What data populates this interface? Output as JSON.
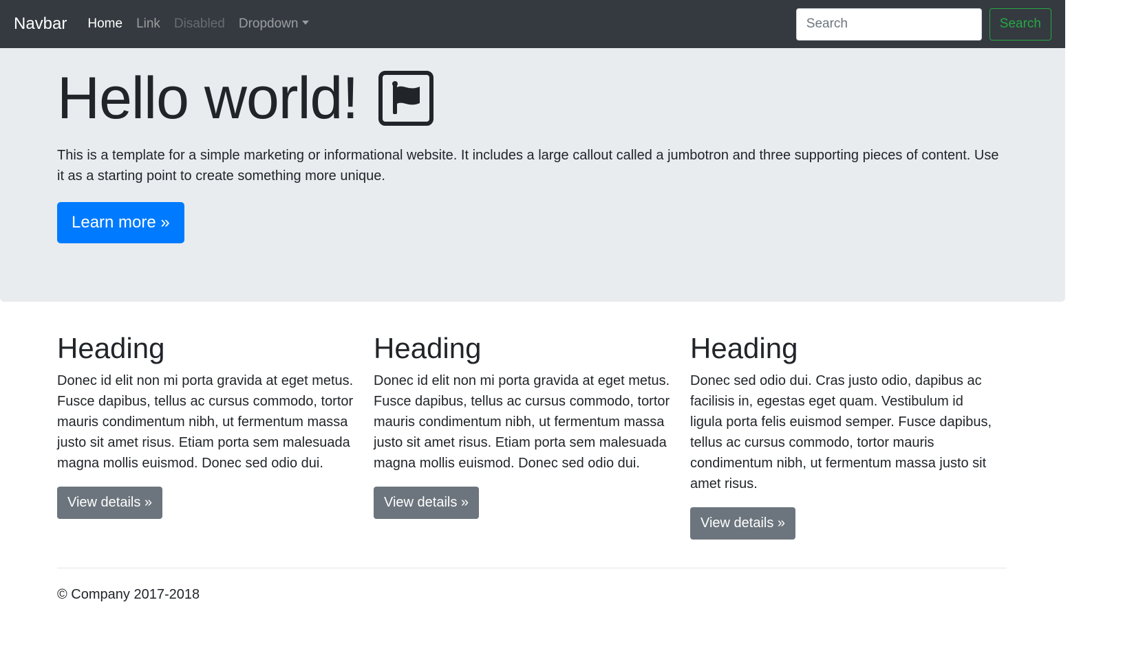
{
  "navbar": {
    "brand": "Navbar",
    "links": {
      "home": "Home",
      "link": "Link",
      "disabled": "Disabled",
      "dropdown": "Dropdown"
    },
    "search_placeholder": "Search",
    "search_button": "Search",
    "colors": {
      "background": "#343a40",
      "search_button": "#28a745"
    }
  },
  "jumbotron": {
    "title": "Hello world!",
    "title_icon": "flag-icon",
    "lead": "This is a template for a simple marketing or informational website. It includes a large callout called a jumbotron and three supporting pieces of content. Use it as a starting point to create something more unique.",
    "cta": "Learn more »",
    "colors": {
      "background": "#e9ecef",
      "cta": "#007bff"
    }
  },
  "columns": [
    {
      "heading": "Heading",
      "text": "Donec id elit non mi porta gravida at eget metus. Fusce dapibus, tellus ac cursus commodo, tortor mauris condimentum nibh, ut fermentum massa justo sit amet risus. Etiam porta sem malesuada magna mollis euismod. Donec sed odio dui.",
      "button": "View details »"
    },
    {
      "heading": "Heading",
      "text": "Donec id elit non mi porta gravida at eget metus. Fusce dapibus, tellus ac cursus commodo, tortor mauris condimentum nibh, ut fermentum massa justo sit amet risus. Etiam porta sem malesuada magna mollis euismod. Donec sed odio dui.",
      "button": "View details »"
    },
    {
      "heading": "Heading",
      "text": "Donec sed odio dui. Cras justo odio, dapibus ac facilisis in, egestas eget quam. Vestibulum id ligula porta felis euismod semper. Fusce dapibus, tellus ac cursus commodo, tortor mauris condimentum nibh, ut fermentum massa justo sit amet risus.",
      "button": "View details »"
    }
  ],
  "footer": {
    "text": "© Company 2017-2018"
  }
}
